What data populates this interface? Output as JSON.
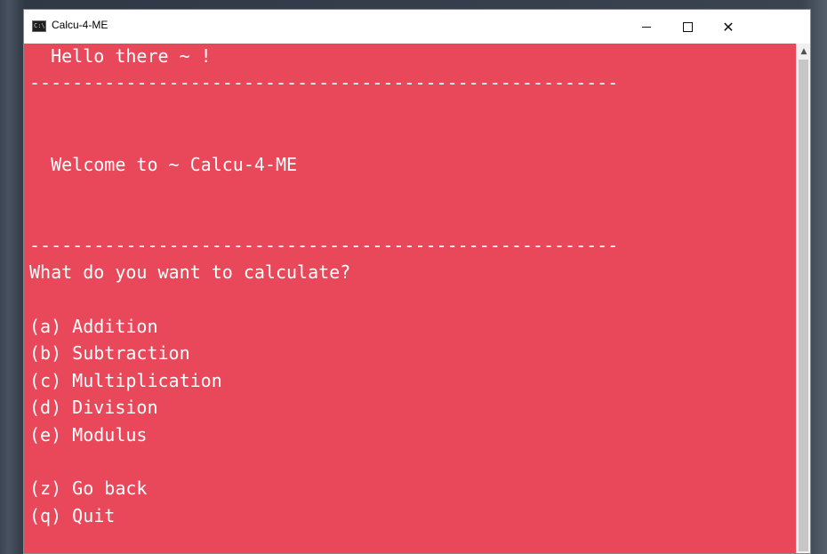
{
  "window": {
    "title": "Calcu-4-ME",
    "icon_label": "C:\\",
    "close_glyph": "✕"
  },
  "console": {
    "lines": [
      "  Hello there ~ !",
      "-------------------------------------------------------",
      "",
      "",
      "  Welcome to ~ Calcu-4-ME",
      "",
      "",
      "-------------------------------------------------------",
      "What do you want to calculate?",
      "",
      "(a) Addition",
      "(b) Subtraction",
      "(c) Multiplication",
      "(d) Division",
      "(e) Modulus",
      "",
      "(z) Go back",
      "(q) Quit",
      "",
      ">>"
    ],
    "background_color": "#e8485a",
    "text_color": "#ffffff"
  },
  "scrollbar": {
    "up_glyph": "▲"
  }
}
